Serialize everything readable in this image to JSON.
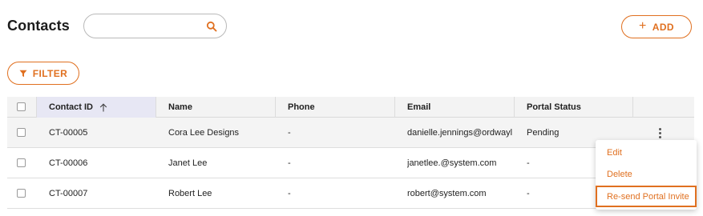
{
  "page": {
    "title": "Contacts"
  },
  "search": {
    "value": "",
    "placeholder": ""
  },
  "toolbar": {
    "add_label": "ADD",
    "add_icon": "plus-icon",
    "filter_label": "FILTER",
    "filter_icon": "funnel-icon"
  },
  "colors": {
    "accent": "#e07020",
    "header_bg": "#f3f3f3",
    "sorted_header_bg": "#e7e7f4",
    "hover_row_bg": "#f4f4f4"
  },
  "table": {
    "columns": [
      "Contact ID",
      "Name",
      "Phone",
      "Email",
      "Portal Status"
    ],
    "sort": {
      "column": "Contact ID",
      "direction": "ascending"
    },
    "rows": [
      {
        "id": "CT-00005",
        "name": "Cora Lee Designs",
        "phone": "-",
        "email": "danielle.jennings@ordwayla",
        "status": "Pending"
      },
      {
        "id": "CT-00006",
        "name": "Janet Lee",
        "phone": "-",
        "email": "janetlee.@system.com",
        "status": "-"
      },
      {
        "id": "CT-00007",
        "name": "Robert Lee",
        "phone": "-",
        "email": "robert@system.com",
        "status": "-"
      }
    ]
  },
  "row_menu": {
    "items": [
      "Edit",
      "Delete",
      "Re-send Portal Invite"
    ],
    "highlighted": "Re-send Portal Invite"
  }
}
